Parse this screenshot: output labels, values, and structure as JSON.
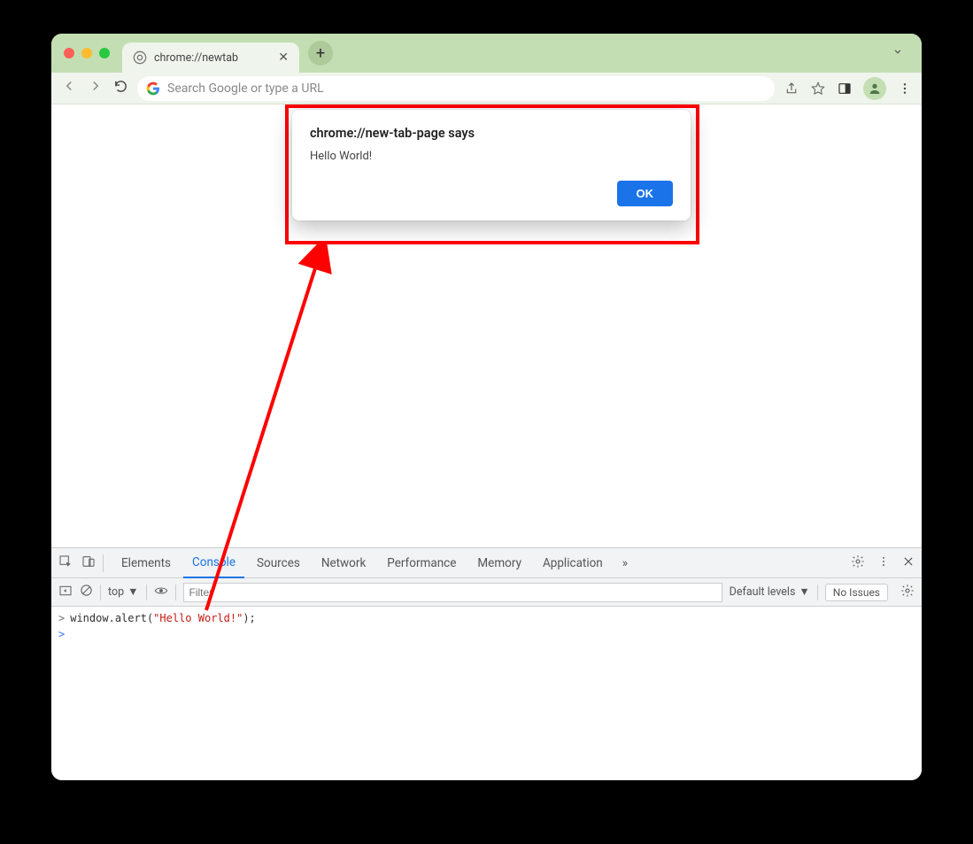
{
  "window": {
    "tab_title": "chrome://newtab"
  },
  "toolbar": {
    "omnibox_placeholder": "Search Google or type a URL"
  },
  "alert": {
    "title": "chrome://new-tab-page says",
    "message": "Hello World!",
    "ok_label": "OK"
  },
  "devtools": {
    "tabs": {
      "elements": "Elements",
      "console": "Console",
      "sources": "Sources",
      "network": "Network",
      "performance": "Performance",
      "memory": "Memory",
      "application": "Application"
    },
    "context": "top",
    "filter_placeholder": "Filter",
    "levels_label": "Default levels",
    "no_issues_label": "No Issues"
  },
  "console": {
    "code_prefix": "window.",
    "code_method": "alert",
    "code_paren_open": "(",
    "code_string": "\"Hello World!\"",
    "code_paren_close": ");"
  }
}
